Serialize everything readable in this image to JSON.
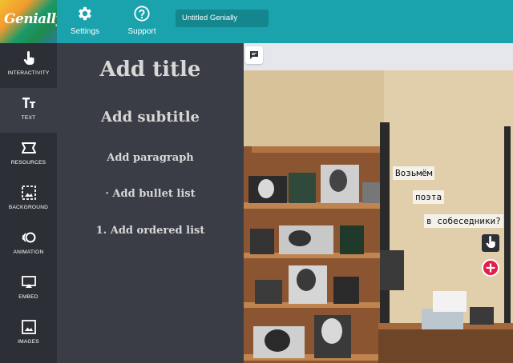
{
  "header": {
    "logo_text": "Genially",
    "settings_label": "Settings",
    "support_label": "Support",
    "project_title": "Untitled Genially"
  },
  "sidebar": {
    "items": [
      {
        "label": "INTERACTIVITY",
        "icon": "hand-pointer-icon"
      },
      {
        "label": "TEXT",
        "icon": "text-icon"
      },
      {
        "label": "RESOURCES",
        "icon": "resources-icon"
      },
      {
        "label": "BACKGROUND",
        "icon": "background-image-icon"
      },
      {
        "label": "ANIMATION",
        "icon": "animation-icon"
      },
      {
        "label": "EMBED",
        "icon": "embed-icon"
      },
      {
        "label": "IMAGES",
        "icon": "image-icon"
      }
    ],
    "active": "TEXT"
  },
  "text_panel": {
    "title": "Add title",
    "subtitle": "Add subtitle",
    "paragraph": "Add paragraph",
    "bullet_list": "· Add bullet list",
    "ordered_list": "1. Add ordered list"
  },
  "canvas": {
    "labels": [
      "Возьмём",
      "поэта",
      "в собеседники?"
    ]
  },
  "colors": {
    "topbar": "#1aa3ad",
    "sidebar": "#2c2f36",
    "panel": "#3a3d45",
    "title_field": "#13868e"
  }
}
